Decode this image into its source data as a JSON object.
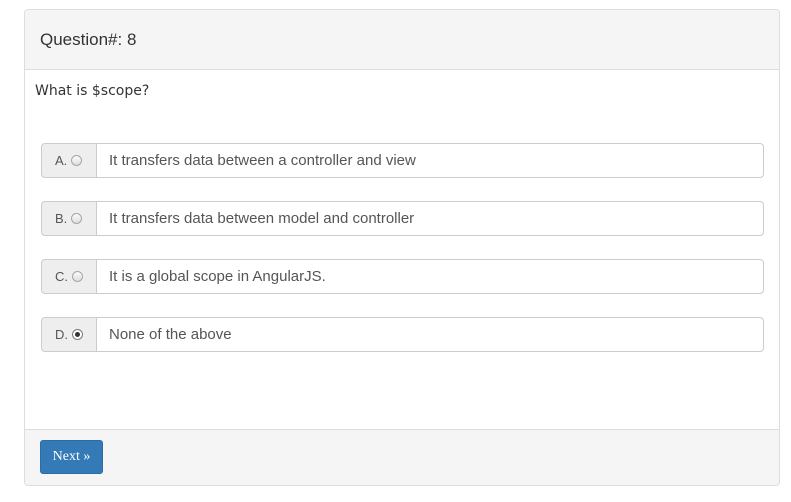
{
  "question": {
    "heading": "Question#: 8",
    "text": "What is $scope?"
  },
  "options": [
    {
      "letter": "A.",
      "text": "It transfers data between a controller and view",
      "selected": false
    },
    {
      "letter": "B.",
      "text": "It transfers data between model and controller",
      "selected": false
    },
    {
      "letter": "C.",
      "text": "It is a global scope in AngularJS.",
      "selected": false
    },
    {
      "letter": "D.",
      "text": "None of the above",
      "selected": true
    }
  ],
  "footer": {
    "next_label": "Next »"
  },
  "colors": {
    "primary": "#337ab7",
    "panel_bg": "#f5f5f5",
    "border": "#dddddd"
  }
}
